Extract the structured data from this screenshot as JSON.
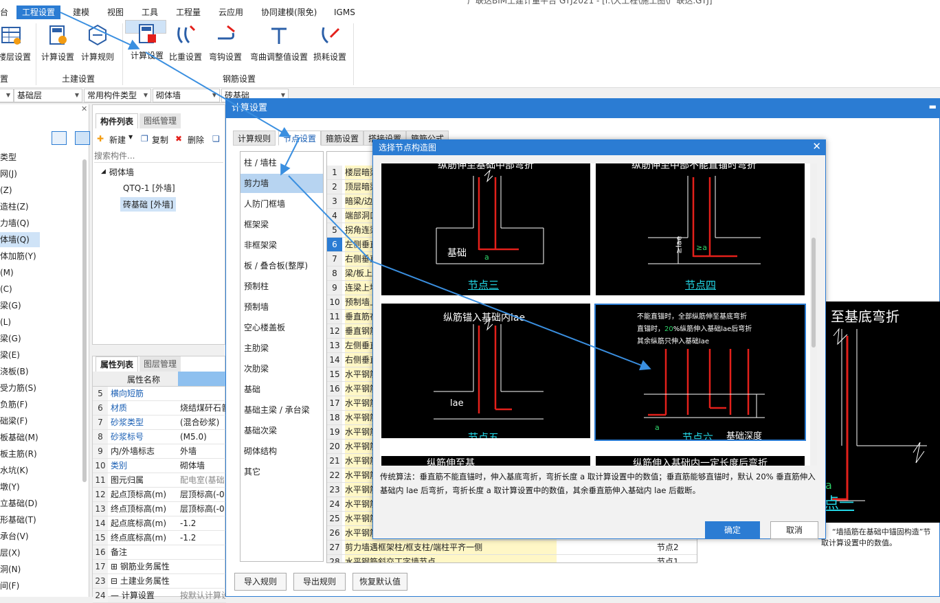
{
  "window": {
    "title": "广联达BIM土建计量平台 GTJ2021 - [i:\\大工程\\施工图\\广联达.GTJ]"
  },
  "menu": [
    "台",
    "工程设置",
    "建模",
    "视图",
    "工具",
    "工程量",
    "云应用",
    "协同建模(限免)",
    "IGMS"
  ],
  "ribbon": {
    "buttons_left": [
      "楼层设置",
      "计算设置",
      "计算规则"
    ],
    "buttons_rebar": [
      "计算设置",
      "比重设置",
      "弯钩设置",
      "弯曲调整值设置",
      "损耗设置"
    ],
    "group_labels": [
      "置",
      "土建设置",
      "钢筋设置"
    ]
  },
  "selectors": [
    "基础层",
    "常用构件类型",
    "砌体墙",
    "砖基础"
  ],
  "leftnav": [
    "类型",
    "网(J)",
    "(Z)",
    "造柱(Z)",
    "力墙(Q)",
    "体墙(Q)",
    "体加筋(Y)",
    "(M)",
    "(C)",
    "梁(G)",
    "(L)",
    "梁(G)",
    "梁(E)",
    "浇板(B)",
    "受力筋(S)",
    "负筋(F)",
    "础梁(F)",
    "板基础(M)",
    "板主筋(R)",
    "水坑(K)",
    "墩(Y)",
    "立基础(D)",
    "形基础(T)",
    "承台(V)",
    "层(X)",
    "洞(N)",
    "间(F)"
  ],
  "component_panel": {
    "tabs": [
      "构件列表",
      "图纸管理"
    ],
    "toolbar": [
      "新建",
      "复制",
      "删除"
    ],
    "search_placeholder": "搜索构件...",
    "tree": {
      "root": "砌体墙",
      "items": [
        "QTQ-1 [外墙]",
        "砖基础 [外墙]"
      ]
    }
  },
  "properties": {
    "tabs": [
      "属性列表",
      "图层管理"
    ],
    "header": "属性名称",
    "rows": [
      {
        "n": "5",
        "k": "横向短筋",
        "v": ""
      },
      {
        "n": "6",
        "k": "材质",
        "v": "烧结煤矸石普"
      },
      {
        "n": "7",
        "k": "砂浆类型",
        "v": "(混合砂浆)"
      },
      {
        "n": "8",
        "k": "砂浆标号",
        "v": "(M5.0)"
      },
      {
        "n": "9",
        "k": "内/外墙标志",
        "v": "外墙"
      },
      {
        "n": "10",
        "k": "类别",
        "v": "砌体墙"
      },
      {
        "n": "11",
        "k": "图元归属",
        "v": "配电室(基础"
      },
      {
        "n": "12",
        "k": "起点顶标高(m)",
        "v": "层顶标高(-0"
      },
      {
        "n": "13",
        "k": "终点顶标高(m)",
        "v": "层顶标高(-0"
      },
      {
        "n": "14",
        "k": "起点底标高(m)",
        "v": "-1.2"
      },
      {
        "n": "15",
        "k": "终点底标高(m)",
        "v": "-1.2"
      },
      {
        "n": "16",
        "k": "备注",
        "v": ""
      },
      {
        "n": "17",
        "k": "⊞ 钢筋业务属性",
        "v": ""
      },
      {
        "n": "23",
        "k": "⊟ 土建业务属性",
        "v": ""
      },
      {
        "n": "24",
        "k": "— 计算设置",
        "v": "按默认计算设"
      }
    ]
  },
  "calc_dialog": {
    "title": "计算设置",
    "tabs": [
      "计算规则",
      "节点设置",
      "箍筋设置",
      "搭接设置",
      "箍筋公式"
    ],
    "categories": [
      "柱 / 墙柱",
      "剪力墙",
      "人防门框墙",
      "框架梁",
      "非框架梁",
      "板 / 叠合板(整厚)",
      "预制柱",
      "预制墙",
      "空心楼盖板",
      "主肋梁",
      "次肋梁",
      "基础",
      "基础主梁 / 承台梁",
      "基础次梁",
      "砌体结构",
      "其它"
    ],
    "rows": [
      {
        "n": "1",
        "t": "楼层暗梁"
      },
      {
        "n": "2",
        "t": "顶层暗梁"
      },
      {
        "n": "3",
        "t": "暗梁/边框"
      },
      {
        "n": "4",
        "t": "端部洞口"
      },
      {
        "n": "5",
        "t": "拐角连梁"
      },
      {
        "n": "6",
        "t": "左侧垂直"
      },
      {
        "n": "7",
        "t": "右侧垂直"
      },
      {
        "n": "8",
        "t": "梁/板上"
      },
      {
        "n": "9",
        "t": "连梁上墙"
      },
      {
        "n": "10",
        "t": "预制墙上"
      },
      {
        "n": "11",
        "t": "垂直筋在"
      },
      {
        "n": "12",
        "t": "垂直钢筋"
      },
      {
        "n": "13",
        "t": "左侧垂直"
      },
      {
        "n": "14",
        "t": "右侧垂直"
      },
      {
        "n": "15",
        "t": "水平钢筋"
      },
      {
        "n": "16",
        "t": "水平钢筋"
      },
      {
        "n": "17",
        "t": "水平钢筋"
      },
      {
        "n": "18",
        "t": "水平钢筋"
      },
      {
        "n": "19",
        "t": "水平钢筋"
      },
      {
        "n": "20",
        "t": "水平钢筋"
      },
      {
        "n": "21",
        "t": "水平钢筋"
      },
      {
        "n": "22",
        "t": "水平钢筋"
      },
      {
        "n": "23",
        "t": "水平钢筋"
      },
      {
        "n": "24",
        "t": "水平钢筋"
      },
      {
        "n": "25",
        "t": "水平钢筋"
      },
      {
        "n": "26",
        "t": "水平钢筋"
      },
      {
        "n": "27",
        "t": "剪力墙遇框架柱/框支柱/端柱平齐一侧",
        "v": "节点2"
      },
      {
        "n": "28",
        "t": "水平钢筋斜交丁字墙节点",
        "v": "节点1"
      }
    ],
    "buttons": [
      "导入规则",
      "导出规则",
      "恢复默认值"
    ],
    "preview": {
      "title": "至基底弯折",
      "label_a": "a",
      "node": "点一"
    },
    "note_line1": "“墙插筋在基础中锚固构造”节",
    "note_line2": "取计算设置中的数值。"
  },
  "node_dialog": {
    "title": "选择节点构造图",
    "nodes": [
      {
        "caption": "节点三",
        "top_text": "纵筋伸至基础中部弯折",
        "label": "基础",
        "a": "a"
      },
      {
        "caption": "节点四",
        "top_text": "纵筋伸至中部不能直锚时弯折",
        "label": "≥lae",
        "a": "≥a"
      },
      {
        "caption": "节点五",
        "top_text": "纵筋锚入基础内lae",
        "label": "lae"
      },
      {
        "caption": "节点六",
        "line1": "不能直锚时，全部纵筋伸至基底弯折",
        "line2a": "直锚时，",
        "line2b": "20",
        "line2c": "%纵筋伸入基础lae后弯折",
        "line3": "其余纵筋只伸入基础lae",
        "label": "基础深度",
        "a": "a"
      }
    ],
    "bottom_titles": [
      "纵筋伸至基",
      "纵筋伸入基础内一定长度后弯折"
    ],
    "description": "传统算法：垂直筋不能直锚时，伸入基底弯折，弯折长度 a 取计算设置中的数值；垂直筋能够直锚时，默认 20% 垂直筋伸入基础内 lae 后弯折，弯折长度 a 取计算设置中的数值，其余垂直筋伸入基础内 lae 后截断。",
    "ok": "确定",
    "cancel": "取消"
  },
  "colors": {
    "accent": "#2b7cd3",
    "rebar": "#e3201b",
    "caption": "#23d7e6",
    "highlight_yellow": "#fff7c6"
  }
}
